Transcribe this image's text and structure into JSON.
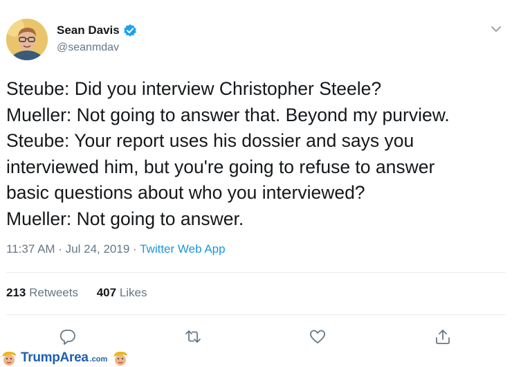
{
  "tweet": {
    "author": {
      "display_name": "Sean Davis",
      "handle": "@seanmdav",
      "verified": true,
      "avatar_icon": "profile-photo"
    },
    "text_lines": [
      "Steube: Did you interview Christopher Steele?",
      "Mueller: Not going to answer that. Beyond my purview.",
      "Steube: Your report uses his dossier and says you",
      "interviewed him, but you're going to refuse to answer",
      "basic questions about who you interviewed?",
      "Mueller: Not going to answer."
    ],
    "timestamp": "11:37 AM · Jul 24, 2019 · ",
    "source": "Twitter Web App",
    "stats": {
      "retweets_count": "213",
      "retweets_label": "Retweets",
      "likes_count": "407",
      "likes_label": "Likes"
    },
    "actions": [
      "reply-icon",
      "retweet-icon",
      "like-icon",
      "share-icon"
    ]
  },
  "watermark": {
    "brand": "TrumpArea",
    "suffix": ".com"
  },
  "colors": {
    "text": "#14171a",
    "secondary": "#657786",
    "link": "#1b95e0",
    "verified": "#1da1f2",
    "divider": "#e6ecf0"
  }
}
